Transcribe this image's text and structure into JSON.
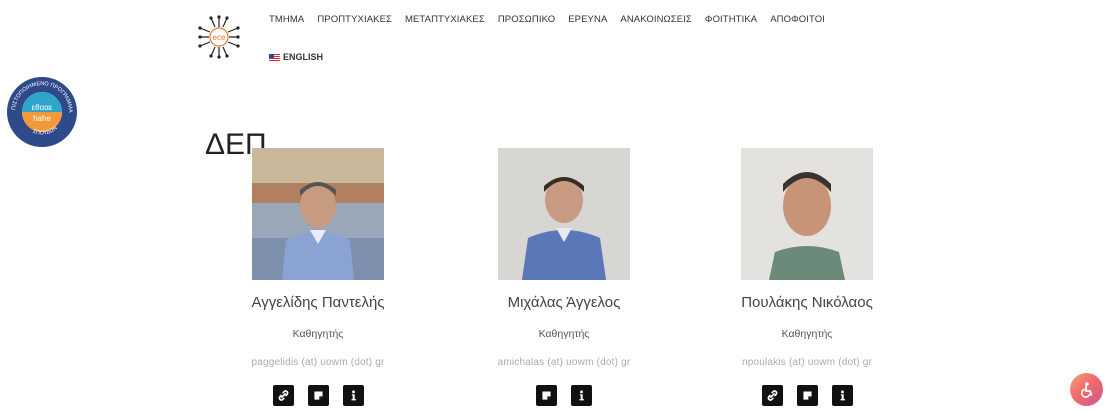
{
  "nav": {
    "items": [
      "ΤΜΗΜΑ",
      "ΠΡΟΠΤΥΧΙΑΚΕΣ",
      "ΜΕΤΑΠΤΥΧΙΑΚΕΣ",
      "ΠΡΟΣΩΠΙΚΟ",
      "ΕΡΕΥΝΑ",
      "ΑΝΑΚΟΙΝΩΣΕΙΣ",
      "ΦΟΙΤΗΤΙΚΑ",
      "ΑΠΟΦΟΙΤΟΙ"
    ],
    "language": "ENGLISH"
  },
  "badge": {
    "top_text": "ΠΙΣΤΟΠΟΙΗΜΕΝΟ ΠΡΟΓΡΑΜΜΑ",
    "bottom_text": "ΣΠΟΥΔΩΝ",
    "center_top": "εθααε",
    "center_bottom": "hahe"
  },
  "page": {
    "title": "ΔΕΠ"
  },
  "staff": [
    {
      "name": "Αγγελίδης Παντελής",
      "role": "Καθηγητής",
      "email": "paggelidis (at) uowm (dot) gr"
    },
    {
      "name": "Μιχάλας Άγγελος",
      "role": "Καθηγητής",
      "email": "amichalas (at) uowm (dot) gr"
    },
    {
      "name": "Πουλάκης Νικόλαος",
      "role": "Καθηγητής",
      "email": "npoulakis (at) uowm (dot) gr"
    }
  ],
  "colors": {
    "icon_bg": "#111111",
    "accessibility_gradient": "#f36a6a"
  },
  "icons": {
    "link": "link-icon",
    "cv": "document-icon",
    "info": "info-icon",
    "accessibility": "accessibility-icon"
  }
}
